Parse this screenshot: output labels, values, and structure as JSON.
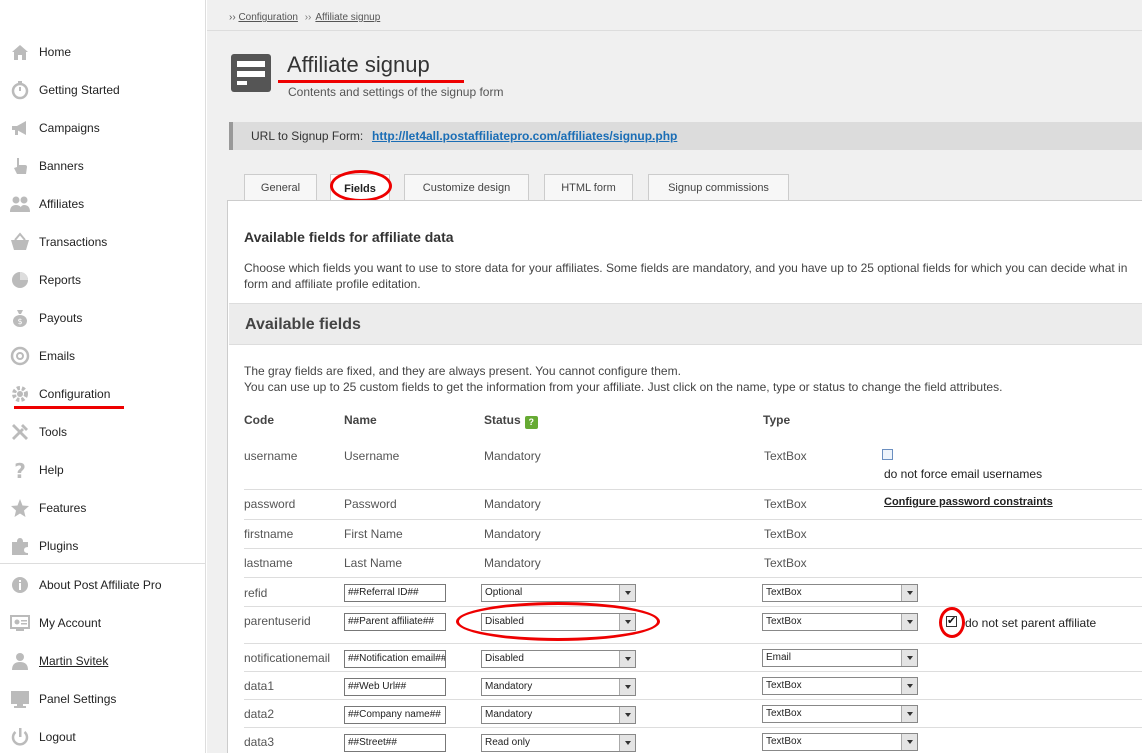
{
  "sidebar": {
    "items": [
      {
        "label": "Home",
        "icon": "home-icon"
      },
      {
        "label": "Getting Started",
        "icon": "stopwatch-icon"
      },
      {
        "label": "Campaigns",
        "icon": "megaphone-icon"
      },
      {
        "label": "Banners",
        "icon": "hand-icon"
      },
      {
        "label": "Affiliates",
        "icon": "users-icon"
      },
      {
        "label": "Transactions",
        "icon": "basket-icon"
      },
      {
        "label": "Reports",
        "icon": "pie-chart-icon"
      },
      {
        "label": "Payouts",
        "icon": "money-bag-icon"
      },
      {
        "label": "Emails",
        "icon": "at-sign-icon"
      },
      {
        "label": "Configuration",
        "icon": "gear-icon"
      },
      {
        "label": "Tools",
        "icon": "tools-icon"
      },
      {
        "label": "Help",
        "icon": "question-icon"
      },
      {
        "label": "Features",
        "icon": "star-icon"
      },
      {
        "label": "Plugins",
        "icon": "puzzle-icon"
      }
    ],
    "bottom_items": [
      {
        "label": "About Post Affiliate Pro",
        "icon": "info-icon"
      },
      {
        "label": "My Account",
        "icon": "account-icon"
      },
      {
        "label": "Martin Svitek",
        "icon": "user-icon"
      },
      {
        "label": "Panel Settings",
        "icon": "monitor-icon"
      },
      {
        "label": "Logout",
        "icon": "power-icon"
      }
    ]
  },
  "breadcrumb": {
    "prefix": "››",
    "items": [
      "Configuration",
      "Affiliate signup"
    ]
  },
  "header": {
    "title": "Affiliate signup",
    "subtitle": "Contents and settings of the signup form"
  },
  "url_bar": {
    "label": "URL to Signup Form:",
    "url": "http://let4all.postaffiliatepro.com/affiliates/signup.php"
  },
  "tabs": [
    "General",
    "Fields",
    "Customize design",
    "HTML form",
    "Signup commissions"
  ],
  "active_tab": "Fields",
  "section1": {
    "title": "Available fields for affiliate data",
    "desc_line1": "Choose which fields you want to use to store data for your affiliates. Some fields are mandatory, and you have up to 25 optional fields for which you can decide what in",
    "desc_line2": "form and affiliate profile editation."
  },
  "section2": {
    "title": "Available fields",
    "desc_line1": "The gray fields are fixed, and they are always present. You cannot configure them.",
    "desc_line2": "You can use up to 25 custom fields to get the information from your affiliate. Just click on the name, type or status to change the field attributes."
  },
  "table": {
    "headers": {
      "code": "Code",
      "name": "Name",
      "status": "Status",
      "help": "?",
      "type": "Type"
    },
    "fixed_rows": [
      {
        "code": "username",
        "name": "Username",
        "status": "Mandatory",
        "type": "TextBox",
        "extra": "do not force email usernames"
      },
      {
        "code": "password",
        "name": "Password",
        "status": "Mandatory",
        "type": "TextBox",
        "extra": "Configure password constraints"
      },
      {
        "code": "firstname",
        "name": "First Name",
        "status": "Mandatory",
        "type": "TextBox"
      },
      {
        "code": "lastname",
        "name": "Last Name",
        "status": "Mandatory",
        "type": "TextBox"
      }
    ],
    "custom_rows": [
      {
        "code": "refid",
        "name": "##Referral ID##",
        "status": "Optional",
        "type": "TextBox"
      },
      {
        "code": "parentuserid",
        "name": "##Parent affiliate##",
        "status": "Disabled",
        "type": "TextBox",
        "extra": "do not set parent affiliate"
      },
      {
        "code": "notificationemail",
        "name": "##Notification email##",
        "status": "Disabled",
        "type": "Email"
      },
      {
        "code": "data1",
        "name": "##Web Url##",
        "status": "Mandatory",
        "type": "TextBox"
      },
      {
        "code": "data2",
        "name": "##Company name##",
        "status": "Mandatory",
        "type": "TextBox"
      },
      {
        "code": "data3",
        "name": "##Street##",
        "status": "Read only",
        "type": "TextBox"
      }
    ]
  },
  "colors": {
    "highlight": "#e00000",
    "link": "#1a6db5"
  }
}
